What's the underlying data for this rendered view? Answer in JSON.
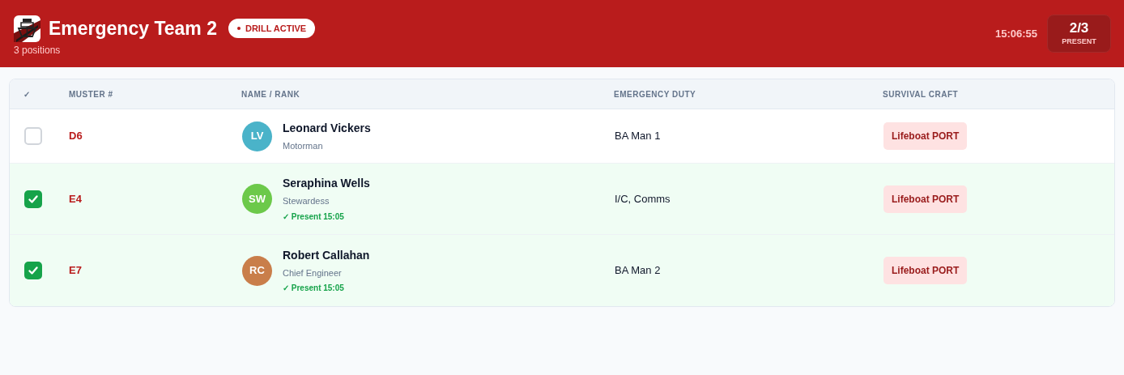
{
  "header": {
    "title": "Emergency Team 2",
    "subtitle": "3 positions",
    "badge": "DRILL ACTIVE",
    "clock": "15:06:55",
    "count": "2/3",
    "count_label": "PRESENT"
  },
  "table": {
    "columns": [
      "✓",
      "MUSTER #",
      "NAME / RANK",
      "EMERGENCY DUTY",
      "SURVIVAL CRAFT"
    ],
    "rows": [
      {
        "checked": false,
        "muster": "D6",
        "initials": "LV",
        "color": "#4ab3c9",
        "name": "Leonard Vickers",
        "rank": "Motorman",
        "duty": "BA Man 1",
        "craft": "Lifeboat PORT"
      },
      {
        "checked": true,
        "muster": "E4",
        "initials": "SW",
        "color": "#6cc94a",
        "name": "Seraphina Wells",
        "rank": "Stewardess",
        "present": "✓ Present 15:05",
        "duty": "I/C, Comms",
        "craft": "Lifeboat PORT"
      },
      {
        "checked": true,
        "muster": "E7",
        "initials": "RC",
        "color": "#c97e4a",
        "name": "Robert Callahan",
        "rank": "Chief Engineer",
        "present": "✓ Present 15:05",
        "duty": "BA Man 2",
        "craft": "Lifeboat PORT"
      }
    ]
  }
}
